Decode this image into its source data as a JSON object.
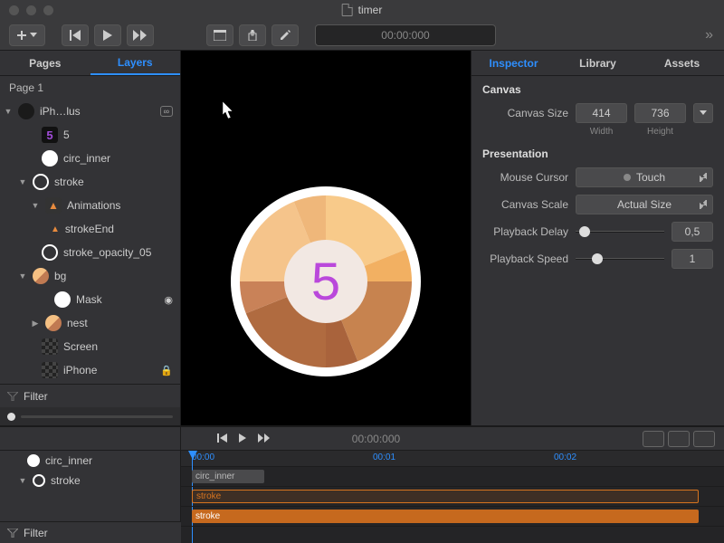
{
  "title": "timer",
  "toolbar": {
    "timecode": "00:00:000"
  },
  "left": {
    "tabs": {
      "pages": "Pages",
      "layers": "Layers"
    },
    "page_header": "Page 1",
    "filter_placeholder": "Filter",
    "layers": [
      {
        "name": "iPh…lus",
        "indent": 0,
        "arrow": "down",
        "thumb": "dark",
        "badge": "∞"
      },
      {
        "name": "5",
        "indent": 1,
        "thumb": "num5"
      },
      {
        "name": "circ_inner",
        "indent": 1,
        "thumb": "circ-white"
      },
      {
        "name": "stroke",
        "indent": 1,
        "arrow": "down",
        "thumb": "circ-outline"
      },
      {
        "name": "Animations",
        "indent": 2,
        "arrow": "down",
        "thumb": "tri"
      },
      {
        "name": "strokeEnd",
        "indent": 3,
        "thumb": "tri-small"
      },
      {
        "name": "stroke_opacity_05",
        "indent": 1,
        "thumb": "circ-outline"
      },
      {
        "name": "bg",
        "indent": 1,
        "arrow": "down",
        "thumb": "orange"
      },
      {
        "name": "Mask",
        "indent": 2,
        "thumb": "circ-white",
        "badge": "mask"
      },
      {
        "name": "nest",
        "indent": 2,
        "arrow": "right",
        "thumb": "orange"
      },
      {
        "name": "Screen",
        "indent": 1,
        "thumb": "check"
      },
      {
        "name": "iPhone",
        "indent": 1,
        "thumb": "check",
        "locked": true
      }
    ]
  },
  "canvas": {
    "number": "5"
  },
  "inspector": {
    "tabs": {
      "inspector": "Inspector",
      "library": "Library",
      "assets": "Assets"
    },
    "sections": {
      "canvas": {
        "title": "Canvas",
        "size_label": "Canvas Size",
        "width": "414",
        "width_label": "Width",
        "height": "736",
        "height_label": "Height"
      },
      "presentation": {
        "title": "Presentation",
        "mouse_cursor_label": "Mouse Cursor",
        "mouse_cursor": "Touch",
        "canvas_scale_label": "Canvas Scale",
        "canvas_scale": "Actual Size",
        "playback_delay_label": "Playback Delay",
        "playback_delay": "0,5",
        "playback_speed_label": "Playback Speed",
        "playback_speed": "1"
      }
    }
  },
  "timeline": {
    "timecode": "00:00:000",
    "ruler": [
      "00:00",
      "00:01",
      "00:02"
    ],
    "label_rows": [
      {
        "name": "circ_inner",
        "thumb": "circ-white"
      },
      {
        "name": "stroke",
        "arrow": "down",
        "thumb": "circ-outline"
      }
    ],
    "clips": {
      "row0": "circ_inner",
      "row1": "stroke",
      "row2": "stroke"
    },
    "filter_placeholder": "Filter"
  }
}
